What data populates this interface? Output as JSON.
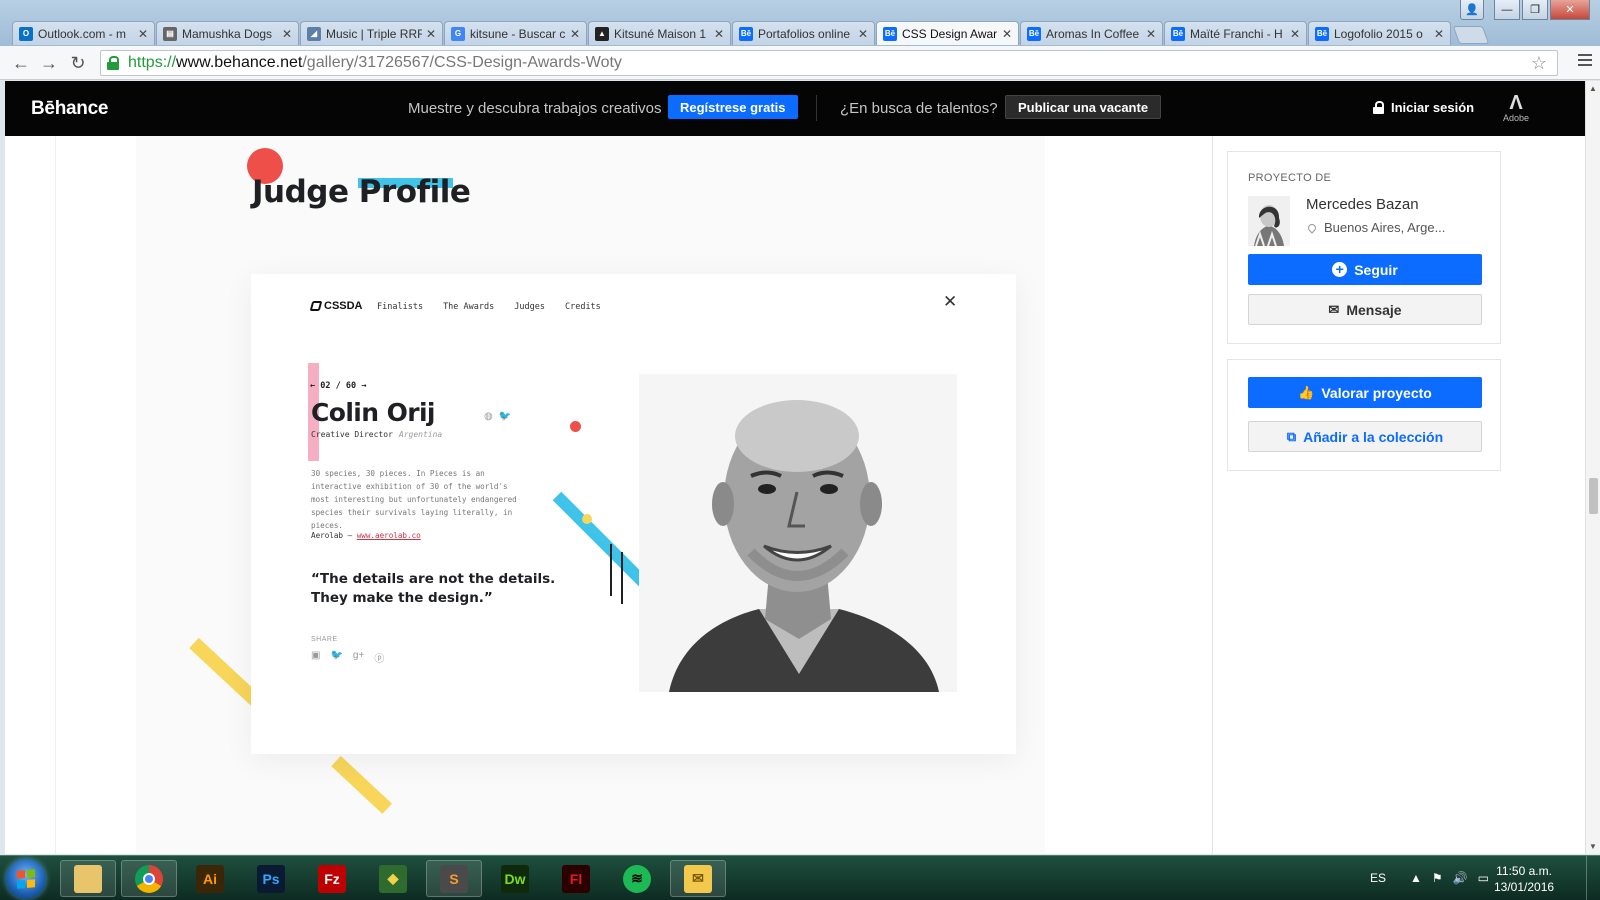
{
  "browser": {
    "tabs": [
      {
        "label": "Outlook.com - m",
        "favicon": "outlook-icon",
        "fav_text": "O",
        "fav_color": "#0a72c6",
        "active": false
      },
      {
        "label": "Mamushka Dogs",
        "favicon": "page-icon",
        "fav_text": "▤",
        "fav_color": "#666666",
        "active": false
      },
      {
        "label": "Music | Triple RRF",
        "favicon": "music-icon",
        "fav_text": "◢",
        "fav_color": "#5b7fa6",
        "active": false
      },
      {
        "label": "kitsune - Buscar c",
        "favicon": "google-icon",
        "fav_text": "G",
        "fav_color": "#4285f4",
        "active": false
      },
      {
        "label": "Kitsuné Maison 1",
        "favicon": "fox-icon",
        "fav_text": "▲",
        "fav_color": "#222222",
        "active": false
      },
      {
        "label": "Portafolios online",
        "favicon": "behance-icon",
        "fav_text": "Bē",
        "fav_color": "#0b6cff",
        "active": false
      },
      {
        "label": "CSS Design Awar",
        "favicon": "behance-icon",
        "fav_text": "Bē",
        "fav_color": "#0b6cff",
        "active": true
      },
      {
        "label": "Aromas In Coffee",
        "favicon": "behance-icon",
        "fav_text": "Bē",
        "fav_color": "#0b6cff",
        "active": false
      },
      {
        "label": "Maïté Franchi - H",
        "favicon": "behance-icon",
        "fav_text": "Bē",
        "fav_color": "#0b6cff",
        "active": false
      },
      {
        "label": "Logofolio 2015 o",
        "favicon": "behance-icon",
        "fav_text": "Bē",
        "fav_color": "#0b6cff",
        "active": false
      }
    ],
    "url": {
      "scheme": "https://",
      "host": "www.behance.net",
      "path": "/gallery/31726567/CSS-Design-Awards-Woty"
    },
    "window_controls": {
      "minimize": "—",
      "maximize": "❐",
      "close": "✕"
    }
  },
  "behance": {
    "logo": "Bēhance",
    "tagline": "Muestre y descubra trabajos creativos",
    "register_button": "Regístrese gratis",
    "talent_text": "¿En busca de talentos?",
    "post_job_button": "Publicar una vacante",
    "login": "Iniciar sesión",
    "adobe_label": "Adobe",
    "accent_color": "#0b6cff"
  },
  "gallery": {
    "section_title": "Judge Profile",
    "card": {
      "logo": "CSSDA",
      "nav": [
        "Finalists",
        "The Awards",
        "Judges",
        "Credits"
      ],
      "counter": {
        "prev": "←",
        "current": "02",
        "sep": " / ",
        "total": "60",
        "next": "→"
      },
      "name": "Colin Orij",
      "role": "Creative Director",
      "country": "Argentina",
      "bio": "30 species, 30 pieces. In Pieces is an interactive exhibition of 30 of the world's most interesting but unfortunately endangered species their survivals laying literally, in pieces.",
      "company": "Aerolab – ",
      "website": "www.aerolab.co",
      "quote": "“The details are not the details. They make the design.”",
      "share_label": "SHARE"
    }
  },
  "sidebar": {
    "project_by_label": "PROYECTO DE",
    "owner_name": "Mercedes Bazan",
    "owner_location": "Buenos Aires, Arge...",
    "follow_button": "Seguir",
    "message_button": "Mensaje",
    "appreciate_button": "Valorar proyecto",
    "add_collection_button": "Añadir a la colección"
  },
  "taskbar": {
    "apps": [
      {
        "name": "explorer-icon",
        "text": "",
        "bg": "#e8c46a",
        "fg": "#5a4010",
        "open": true
      },
      {
        "name": "chrome-icon",
        "text": "",
        "bg": "#ffffff",
        "fg": "#000000",
        "open": true
      },
      {
        "name": "illustrator-icon",
        "text": "Ai",
        "bg": "#3b2708",
        "fg": "#ff9a00",
        "open": false
      },
      {
        "name": "photoshop-icon",
        "text": "Ps",
        "bg": "#091a33",
        "fg": "#31a8ff",
        "open": false
      },
      {
        "name": "filezilla-icon",
        "text": "Fz",
        "bg": "#bf0000",
        "fg": "#ffffff",
        "open": false
      },
      {
        "name": "layers-icon",
        "text": "◆",
        "bg": "#2f6b2f",
        "fg": "#f2d24b",
        "open": false
      },
      {
        "name": "sublime-icon",
        "text": "S",
        "bg": "#4a4a4a",
        "fg": "#f79a32",
        "open": true
      },
      {
        "name": "dreamweaver-icon",
        "text": "Dw",
        "bg": "#0e2a0b",
        "fg": "#7ddc1f",
        "open": false
      },
      {
        "name": "flash-icon",
        "text": "Fl",
        "bg": "#2a0000",
        "fg": "#e41b17",
        "open": false
      },
      {
        "name": "spotify-icon",
        "text": "≋",
        "bg": "#1db954",
        "fg": "#000000",
        "open": false
      },
      {
        "name": "outlook-tb-icon",
        "text": "✉",
        "bg": "#f2c94c",
        "fg": "#7a5a00",
        "open": true
      }
    ],
    "lang": "ES",
    "time": "11:50 a.m.",
    "date": "13/01/2016"
  }
}
